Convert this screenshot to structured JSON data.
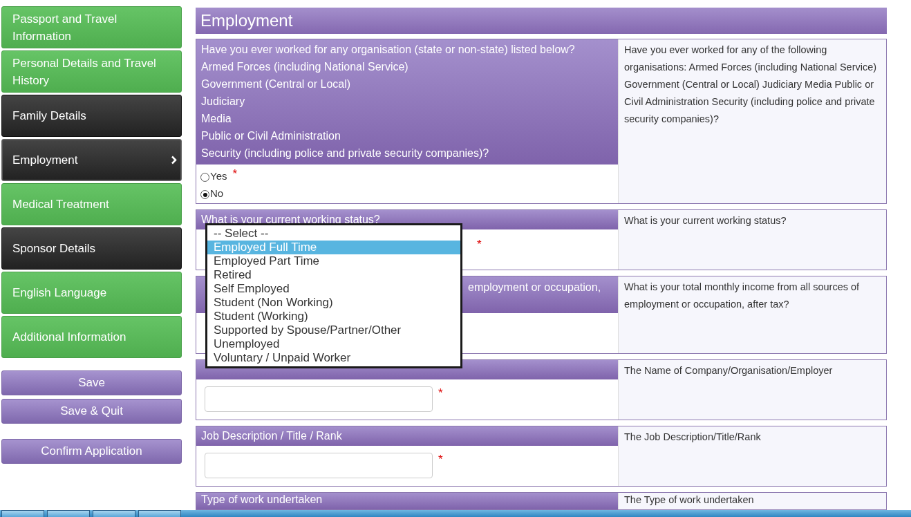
{
  "sidebar": {
    "items": [
      {
        "label": "Passport and Travel Information",
        "complete": true,
        "selected": false
      },
      {
        "label": "Personal Details and Travel History",
        "complete": true,
        "selected": false
      },
      {
        "label": "Family Details",
        "complete": false,
        "selected": false
      },
      {
        "label": "Employment",
        "complete": false,
        "selected": true
      },
      {
        "label": "Medical Treatment",
        "complete": true,
        "selected": false
      },
      {
        "label": "Sponsor Details",
        "complete": false,
        "selected": false
      },
      {
        "label": "English Language",
        "complete": true,
        "selected": false
      },
      {
        "label": "Additional Information",
        "complete": true,
        "selected": false
      }
    ],
    "button_groups": [
      {
        "buttons": [
          "Save",
          "Save & Quit"
        ]
      },
      {
        "buttons": [
          "Confirm Application"
        ]
      }
    ]
  },
  "page_title": "Employment",
  "sections": [
    {
      "kind": "radio",
      "question_lines": [
        "Have you ever worked for any organisation (state or non-state) listed below?",
        "Armed Forces (including National Service)",
        "Government (Central or Local)",
        "Judiciary",
        "Media",
        "Public or Civil Administration",
        "Security (including police and private security companies)?"
      ],
      "required_mark": "*",
      "options": [
        {
          "label": "Yes",
          "selected": false
        },
        {
          "label": "No",
          "selected": true
        }
      ],
      "help": "Have you ever worked for any of the following organisations: Armed Forces (including National Service) Government (Central or Local) Judiciary Media Public or Civil Administration Security (including police and private security companies)?"
    },
    {
      "kind": "select",
      "question_lines": [
        "What is your current working status?"
      ],
      "required_mark": "*",
      "dropdown": {
        "options": [
          {
            "label": "-- Select --",
            "selected": false
          },
          {
            "label": "Employed Full Time",
            "selected": true
          },
          {
            "label": "Employed Part Time",
            "selected": false
          },
          {
            "label": "Retired",
            "selected": false
          },
          {
            "label": "Self Employed",
            "selected": false
          },
          {
            "label": "Student (Non Working)",
            "selected": false
          },
          {
            "label": "Student (Working)",
            "selected": false
          },
          {
            "label": "Supported by Spouse/Partner/Other",
            "selected": false
          },
          {
            "label": "Unemployed",
            "selected": false
          },
          {
            "label": "Voluntary / Unpaid Worker",
            "selected": false
          }
        ]
      },
      "help": "What is your current working status?"
    },
    {
      "kind": "covered",
      "question_lines": [
        "employment or occupation,"
      ],
      "obscured": true,
      "help": "What is your total monthly income from all sources of employment or occupation, after tax?"
    },
    {
      "kind": "text",
      "required_mark": "*",
      "help": "The Name of Company/Organisation/Employer"
    },
    {
      "kind": "text",
      "question_lines": [
        "Job Description / Title / Rank"
      ],
      "required_mark": "*",
      "help": "The Job Description/Title/Rank"
    },
    {
      "kind": "cut",
      "question_lines": [
        "Type of work undertaken"
      ],
      "help": "The Type of work undertaken"
    }
  ]
}
